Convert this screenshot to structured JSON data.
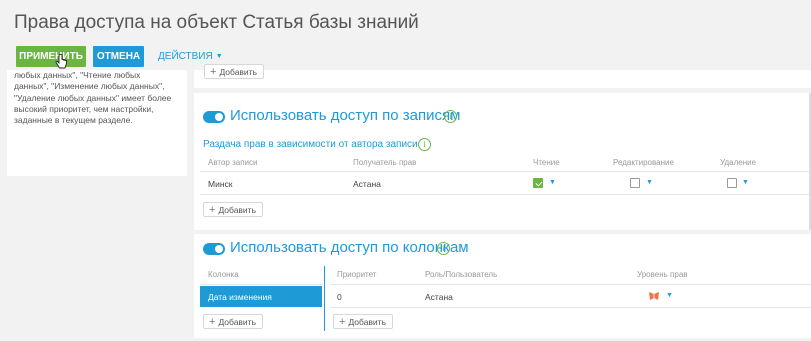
{
  "page": {
    "title": "Права доступа на объект Статья базы знаний"
  },
  "toolbar": {
    "apply_label": "ПРИМЕНИТЬ",
    "cancel_label": "ОТМЕНА",
    "actions_label": "ДЕЙСТВИЯ"
  },
  "left_panel": {
    "text": "любых данных\", \"Чтение любых\nданных\", \"Изменение любых данных\",\n\"Удаление любых данных\" имеет более\nвысокий приоритет, чем настройки,\nзаданные в текущем разделе."
  },
  "top_card": {
    "add_label": "Добавить"
  },
  "records_section": {
    "title": "Использовать доступ по записям",
    "toggle_on": true,
    "subsection_title": "Раздача прав в зависимости от автора записи",
    "columns": [
      "Автор записи",
      "Получатель прав",
      "Чтение",
      "Редактирование",
      "Удаление"
    ],
    "rows": [
      {
        "author": "Минск",
        "recipient": "Астана",
        "read": true,
        "edit": false,
        "delete": false
      }
    ],
    "add_label": "Добавить"
  },
  "columns_section": {
    "title": "Использовать доступ по колонкам",
    "toggle_on": true,
    "left_header": "Колонка",
    "left_rows": [
      "Дата изменения"
    ],
    "left_add_label": "Добавить",
    "right_columns": [
      "Приоритет",
      "Роль/Пользователь",
      "Уровень прав"
    ],
    "right_rows": [
      {
        "priority": "0",
        "role": "Астана"
      }
    ],
    "right_add_label": "Добавить"
  },
  "colors": {
    "accent_blue": "#1e9bd7",
    "apply_green": "#6bb643",
    "checkbox_green": "#6bb643",
    "level_icon": "#e8784a"
  }
}
